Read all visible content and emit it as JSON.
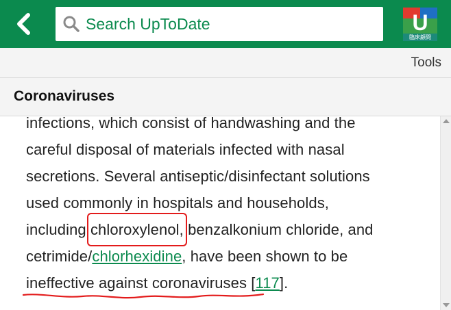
{
  "header": {
    "back_icon": "chevron-left-icon",
    "search_icon": "search-icon",
    "search_placeholder": "Search UpToDate",
    "brand_color": "#0b8a4e",
    "logo_letter": "U",
    "logo_caption": "臨床顧問"
  },
  "toolbar": {
    "tools_label": "Tools"
  },
  "article": {
    "title": "Coronaviruses",
    "lines": {
      "l1": "infections, which consist of handwashing and the",
      "l2": "careful disposal of materials infected with nasal",
      "l3": "secretions. Several antiseptic/disinfectant solutions",
      "l4": "used commonly in hospitals and households,",
      "l5_pre": "including ",
      "l5_boxed": "chloroxylenol,",
      "l5_post": " benzalkonium chloride, and",
      "l6_pre": "cetrimide/",
      "l6_link": "chlorhexidine",
      "l6_post": ", have been shown to be",
      "l7_pre": "ineffective against coronaviruses [",
      "l7_ref": "117",
      "l7_post": "]."
    }
  },
  "annotation_color": "#e31b1b"
}
